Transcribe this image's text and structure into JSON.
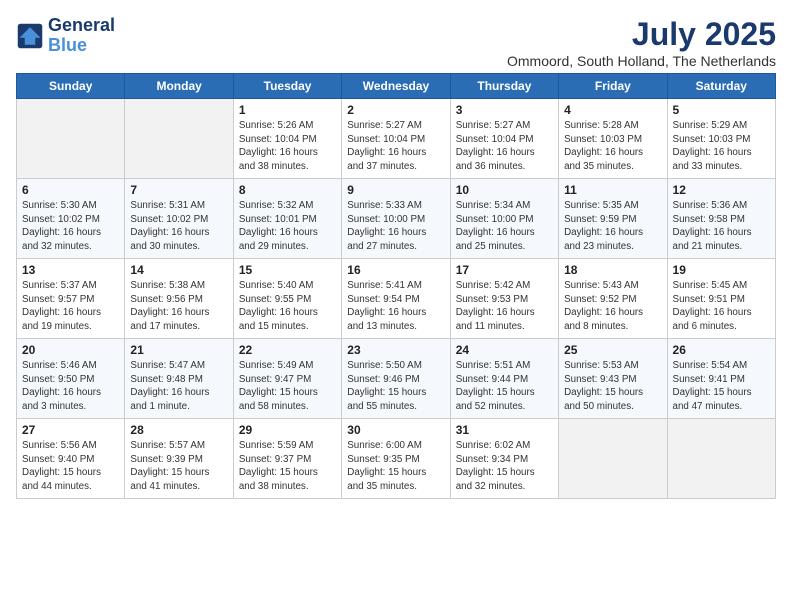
{
  "header": {
    "logo_line1": "General",
    "logo_line2": "Blue",
    "month": "July 2025",
    "location": "Ommoord, South Holland, The Netherlands"
  },
  "weekdays": [
    "Sunday",
    "Monday",
    "Tuesday",
    "Wednesday",
    "Thursday",
    "Friday",
    "Saturday"
  ],
  "weeks": [
    [
      {
        "day": "",
        "info": ""
      },
      {
        "day": "",
        "info": ""
      },
      {
        "day": "1",
        "info": "Sunrise: 5:26 AM\nSunset: 10:04 PM\nDaylight: 16 hours and 38 minutes."
      },
      {
        "day": "2",
        "info": "Sunrise: 5:27 AM\nSunset: 10:04 PM\nDaylight: 16 hours and 37 minutes."
      },
      {
        "day": "3",
        "info": "Sunrise: 5:27 AM\nSunset: 10:04 PM\nDaylight: 16 hours and 36 minutes."
      },
      {
        "day": "4",
        "info": "Sunrise: 5:28 AM\nSunset: 10:03 PM\nDaylight: 16 hours and 35 minutes."
      },
      {
        "day": "5",
        "info": "Sunrise: 5:29 AM\nSunset: 10:03 PM\nDaylight: 16 hours and 33 minutes."
      }
    ],
    [
      {
        "day": "6",
        "info": "Sunrise: 5:30 AM\nSunset: 10:02 PM\nDaylight: 16 hours and 32 minutes."
      },
      {
        "day": "7",
        "info": "Sunrise: 5:31 AM\nSunset: 10:02 PM\nDaylight: 16 hours and 30 minutes."
      },
      {
        "day": "8",
        "info": "Sunrise: 5:32 AM\nSunset: 10:01 PM\nDaylight: 16 hours and 29 minutes."
      },
      {
        "day": "9",
        "info": "Sunrise: 5:33 AM\nSunset: 10:00 PM\nDaylight: 16 hours and 27 minutes."
      },
      {
        "day": "10",
        "info": "Sunrise: 5:34 AM\nSunset: 10:00 PM\nDaylight: 16 hours and 25 minutes."
      },
      {
        "day": "11",
        "info": "Sunrise: 5:35 AM\nSunset: 9:59 PM\nDaylight: 16 hours and 23 minutes."
      },
      {
        "day": "12",
        "info": "Sunrise: 5:36 AM\nSunset: 9:58 PM\nDaylight: 16 hours and 21 minutes."
      }
    ],
    [
      {
        "day": "13",
        "info": "Sunrise: 5:37 AM\nSunset: 9:57 PM\nDaylight: 16 hours and 19 minutes."
      },
      {
        "day": "14",
        "info": "Sunrise: 5:38 AM\nSunset: 9:56 PM\nDaylight: 16 hours and 17 minutes."
      },
      {
        "day": "15",
        "info": "Sunrise: 5:40 AM\nSunset: 9:55 PM\nDaylight: 16 hours and 15 minutes."
      },
      {
        "day": "16",
        "info": "Sunrise: 5:41 AM\nSunset: 9:54 PM\nDaylight: 16 hours and 13 minutes."
      },
      {
        "day": "17",
        "info": "Sunrise: 5:42 AM\nSunset: 9:53 PM\nDaylight: 16 hours and 11 minutes."
      },
      {
        "day": "18",
        "info": "Sunrise: 5:43 AM\nSunset: 9:52 PM\nDaylight: 16 hours and 8 minutes."
      },
      {
        "day": "19",
        "info": "Sunrise: 5:45 AM\nSunset: 9:51 PM\nDaylight: 16 hours and 6 minutes."
      }
    ],
    [
      {
        "day": "20",
        "info": "Sunrise: 5:46 AM\nSunset: 9:50 PM\nDaylight: 16 hours and 3 minutes."
      },
      {
        "day": "21",
        "info": "Sunrise: 5:47 AM\nSunset: 9:48 PM\nDaylight: 16 hours and 1 minute."
      },
      {
        "day": "22",
        "info": "Sunrise: 5:49 AM\nSunset: 9:47 PM\nDaylight: 15 hours and 58 minutes."
      },
      {
        "day": "23",
        "info": "Sunrise: 5:50 AM\nSunset: 9:46 PM\nDaylight: 15 hours and 55 minutes."
      },
      {
        "day": "24",
        "info": "Sunrise: 5:51 AM\nSunset: 9:44 PM\nDaylight: 15 hours and 52 minutes."
      },
      {
        "day": "25",
        "info": "Sunrise: 5:53 AM\nSunset: 9:43 PM\nDaylight: 15 hours and 50 minutes."
      },
      {
        "day": "26",
        "info": "Sunrise: 5:54 AM\nSunset: 9:41 PM\nDaylight: 15 hours and 47 minutes."
      }
    ],
    [
      {
        "day": "27",
        "info": "Sunrise: 5:56 AM\nSunset: 9:40 PM\nDaylight: 15 hours and 44 minutes."
      },
      {
        "day": "28",
        "info": "Sunrise: 5:57 AM\nSunset: 9:39 PM\nDaylight: 15 hours and 41 minutes."
      },
      {
        "day": "29",
        "info": "Sunrise: 5:59 AM\nSunset: 9:37 PM\nDaylight: 15 hours and 38 minutes."
      },
      {
        "day": "30",
        "info": "Sunrise: 6:00 AM\nSunset: 9:35 PM\nDaylight: 15 hours and 35 minutes."
      },
      {
        "day": "31",
        "info": "Sunrise: 6:02 AM\nSunset: 9:34 PM\nDaylight: 15 hours and 32 minutes."
      },
      {
        "day": "",
        "info": ""
      },
      {
        "day": "",
        "info": ""
      }
    ]
  ]
}
